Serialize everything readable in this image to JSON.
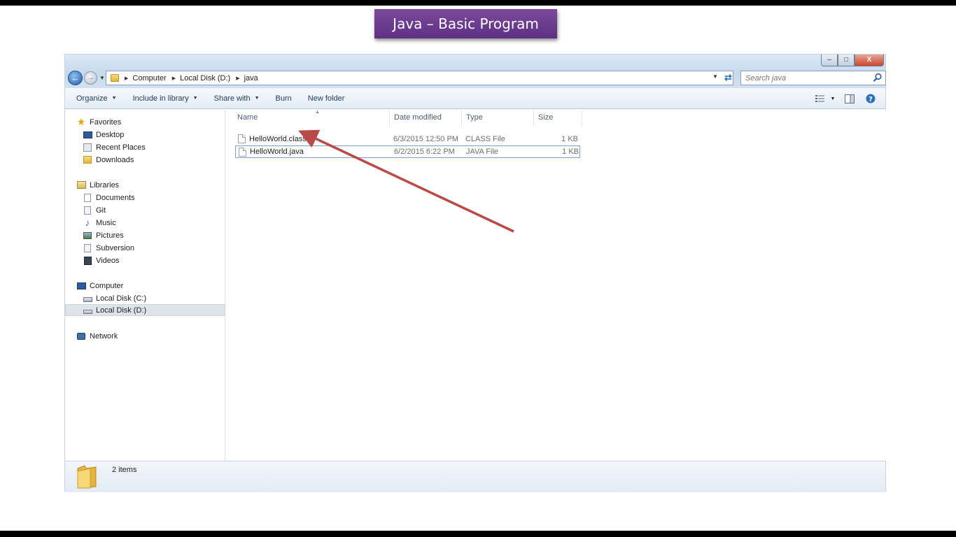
{
  "slide": {
    "title": "Java – Basic Program"
  },
  "window": {
    "controls": {
      "minimize": "–",
      "maximize": "□",
      "close": "X"
    }
  },
  "address": {
    "crumbs": [
      "Computer",
      "Local Disk (D:)",
      "java"
    ]
  },
  "search": {
    "placeholder": "Search java"
  },
  "toolbar": {
    "organize": "Organize",
    "include_library": "Include in library",
    "share_with": "Share with",
    "burn": "Burn",
    "new_folder": "New folder"
  },
  "sidebar": {
    "favorites": {
      "label": "Favorites",
      "items": [
        "Desktop",
        "Recent Places",
        "Downloads"
      ]
    },
    "libraries": {
      "label": "Libraries",
      "items": [
        "Documents",
        "Git",
        "Music",
        "Pictures",
        "Subversion",
        "Videos"
      ]
    },
    "computer": {
      "label": "Computer",
      "items": [
        "Local Disk (C:)",
        "Local Disk (D:)"
      ]
    },
    "network": {
      "label": "Network"
    }
  },
  "columns": {
    "name": "Name",
    "date": "Date modified",
    "type": "Type",
    "size": "Size"
  },
  "files": [
    {
      "name": "HelloWorld.class",
      "date": "6/3/2015 12:50 PM",
      "type": "CLASS File",
      "size": "1 KB"
    },
    {
      "name": "HelloWorld.java",
      "date": "6/2/2015 6:22 PM",
      "type": "JAVA File",
      "size": "1 KB"
    }
  ],
  "status": {
    "items_count": "2 items"
  },
  "colors": {
    "banner": "#6a3a8e",
    "arrow": "#b94a48",
    "selection": "#7da2ce"
  }
}
